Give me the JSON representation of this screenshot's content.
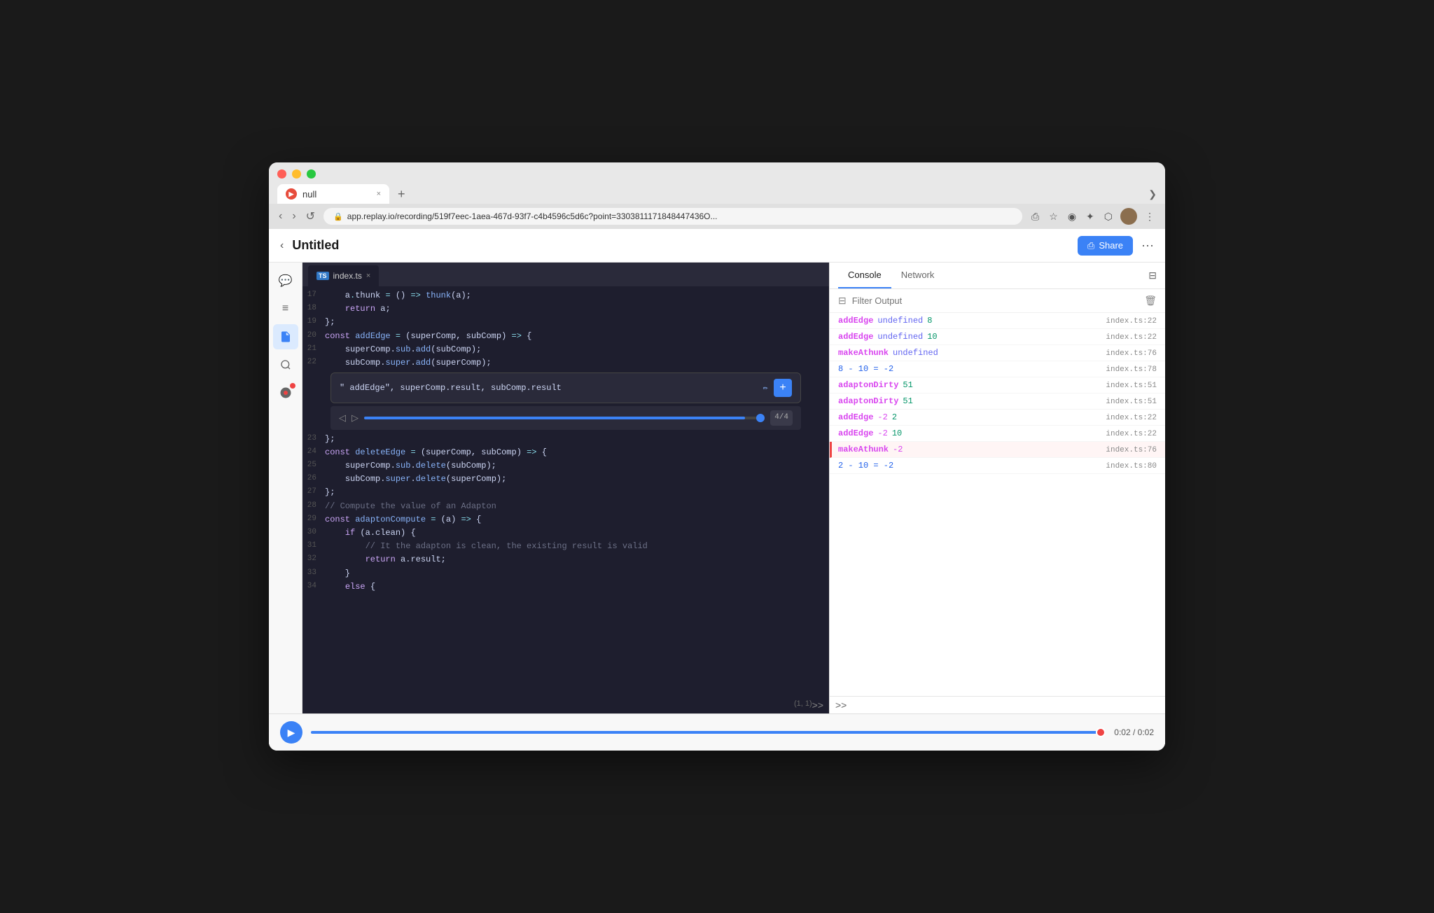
{
  "browser": {
    "tab_title": "null",
    "url": "app.replay.io/recording/519f7eec-1aea-467d-93f7-c4b4596c5d6c?point=3303811171848447436O...",
    "new_tab_icon": "+",
    "overflow_icon": "❯",
    "back_icon": "‹",
    "forward_icon": "›",
    "refresh_icon": "↺",
    "close_icon": "×",
    "bookmark_icon": "☆",
    "extensions": [
      "◉",
      "✦",
      "⬡"
    ],
    "more_icon": "⋮"
  },
  "app": {
    "title": "Untitled",
    "back_label": "‹",
    "share_label": "Share",
    "more_label": "···"
  },
  "sidebar": {
    "icons": [
      {
        "name": "comments-icon",
        "symbol": "💬",
        "active": false
      },
      {
        "name": "list-icon",
        "symbol": "☰",
        "active": false
      },
      {
        "name": "file-icon",
        "symbol": "📄",
        "active": true
      },
      {
        "name": "search-icon",
        "symbol": "🔍",
        "active": false
      },
      {
        "name": "debug-icon",
        "symbol": "⏺",
        "active": false,
        "red_dot": true
      }
    ]
  },
  "code_editor": {
    "filename": "index.ts",
    "close_icon": "×",
    "lines": [
      {
        "num": 17,
        "code": "    a.thunk = () => thunk(a);"
      },
      {
        "num": 18,
        "code": "    return a;"
      },
      {
        "num": 19,
        "code": "};"
      },
      {
        "num": 20,
        "code": "const addEdge = (superComp, subComp) => {"
      },
      {
        "num": 21,
        "code": "    superComp.sub.add(subComp);"
      },
      {
        "num": 22,
        "code": "    subComp.super.add(superComp);"
      },
      {
        "num": 23,
        "code": "};"
      },
      {
        "num": 24,
        "code": "const deleteEdge = (superComp, subComp) => {"
      },
      {
        "num": 25,
        "code": "    superComp.sub.delete(subComp);"
      },
      {
        "num": 26,
        "code": "    subComp.super.delete(superComp);"
      },
      {
        "num": 27,
        "code": "};"
      },
      {
        "num": 28,
        "code": "// Compute the value of an Adapton"
      },
      {
        "num": 29,
        "code": "const adaptonCompute = (a) => {"
      },
      {
        "num": 30,
        "code": "    if (a.clean) {"
      },
      {
        "num": 31,
        "code": "        // It the adapton is clean, the existing result is valid"
      },
      {
        "num": 32,
        "code": "        return a.result;"
      },
      {
        "num": 33,
        "code": "    }"
      },
      {
        "num": 34,
        "code": "    else {"
      }
    ],
    "popup": {
      "text": "\" addEdge\", superComp.result, subComp.result",
      "edit_icon": "✏",
      "add_icon": "+"
    },
    "scrubber": {
      "prev_icon": "◁",
      "next_icon": "▷",
      "counter": "4/4"
    },
    "position": "(1, 1)",
    "expand_icon": ">>"
  },
  "console_panel": {
    "tabs": [
      {
        "label": "Console",
        "active": true
      },
      {
        "label": "Network",
        "active": false
      }
    ],
    "panel_icon": "⊟",
    "filter_placeholder": "Filter Output",
    "filter_sidebar_icon": "⊟",
    "clear_icon": "🗑",
    "rows": [
      {
        "name": "addEdge",
        "val": "undefined",
        "val2": "8",
        "loc": "index.ts:22",
        "highlighted": false
      },
      {
        "name": "addEdge",
        "val": "undefined",
        "val2": "10",
        "loc": "index.ts:22",
        "highlighted": false
      },
      {
        "name": "makeAthunk",
        "val": "undefined",
        "val2": "",
        "loc": "index.ts:76",
        "highlighted": false
      },
      {
        "name": null,
        "expr": "8 - 10 = -2",
        "loc": "index.ts:78",
        "highlighted": false
      },
      {
        "name": "adaptonDirty",
        "val": "51",
        "val2": "",
        "loc": "index.ts:51",
        "highlighted": false
      },
      {
        "name": "adaptonDirty",
        "val": "51",
        "val2": "",
        "loc": "index.ts:51",
        "highlighted": false
      },
      {
        "name": "addEdge",
        "val": "-2",
        "val2": "2",
        "loc": "index.ts:22",
        "highlighted": false
      },
      {
        "name": "addEdge",
        "val": "-2",
        "val2": "10",
        "loc": "index.ts:22",
        "highlighted": false
      },
      {
        "name": "makeAthunk",
        "val": "-2",
        "val2": "",
        "loc": "index.ts:76",
        "highlighted": true
      },
      {
        "name": null,
        "expr": "2 - 10 = -2",
        "loc": "index.ts:80",
        "highlighted": false
      }
    ],
    "expand_icon": ">>"
  },
  "playback": {
    "play_icon": "▶",
    "time": "0:02 / 0:02"
  }
}
